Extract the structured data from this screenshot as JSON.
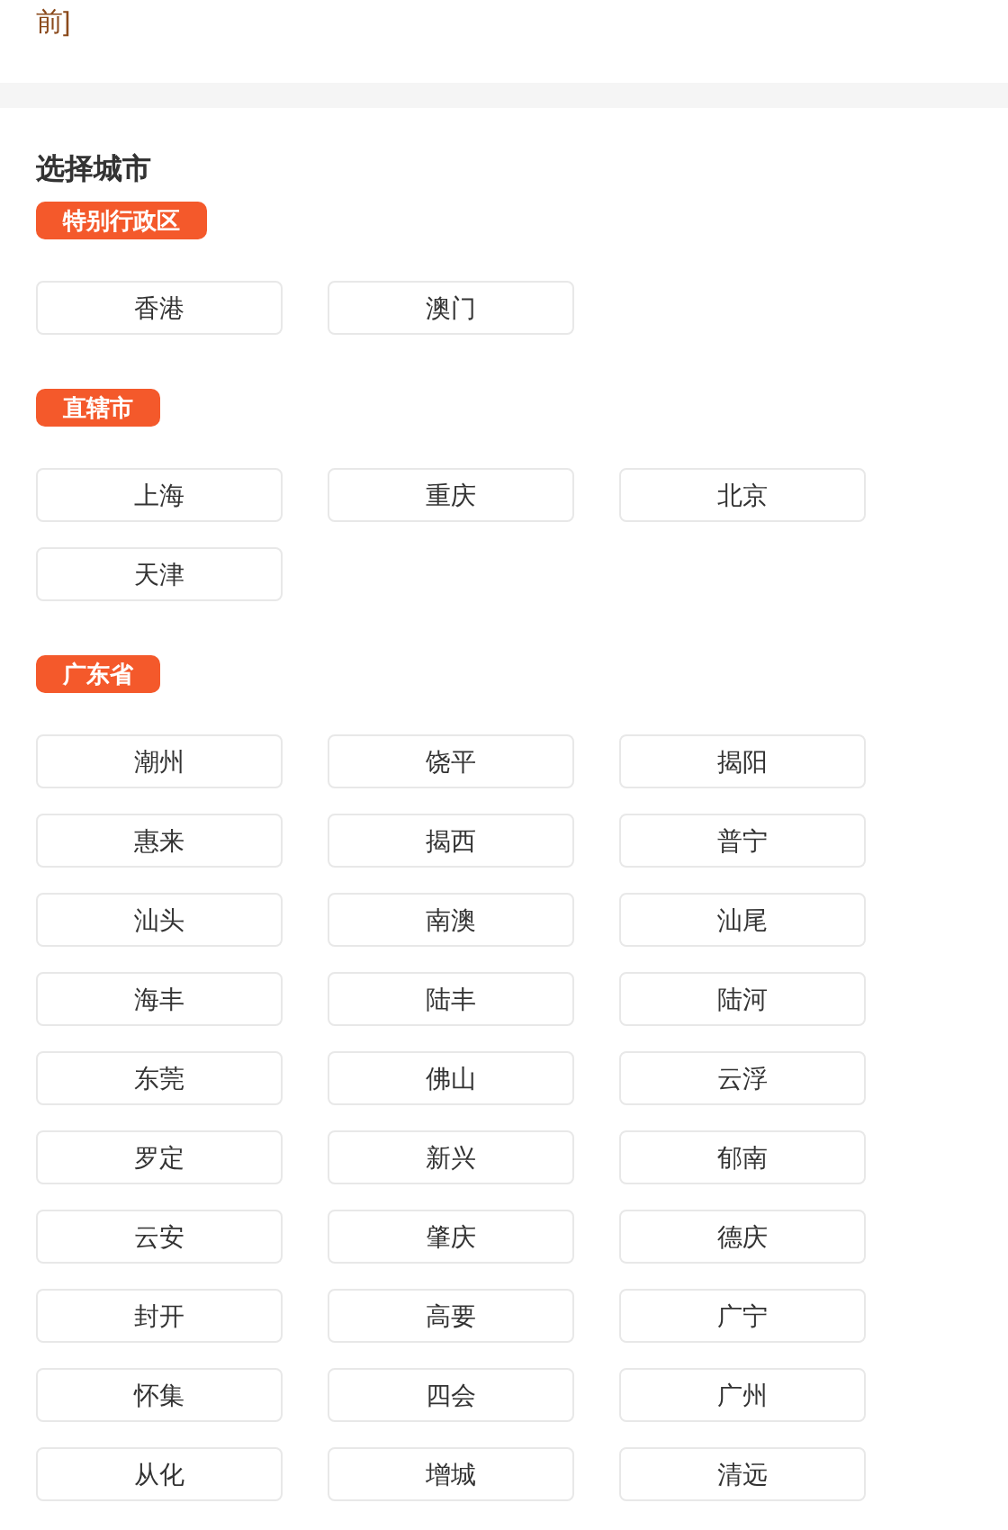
{
  "top_text": "前]",
  "title": "选择城市",
  "groups": [
    {
      "label": "特别行政区",
      "cities": [
        "香港",
        "澳门"
      ]
    },
    {
      "label": "直辖市",
      "cities": [
        "上海",
        "重庆",
        "北京",
        "天津"
      ]
    },
    {
      "label": "广东省",
      "cities": [
        "潮州",
        "饶平",
        "揭阳",
        "惠来",
        "揭西",
        "普宁",
        "汕头",
        "南澳",
        "汕尾",
        "海丰",
        "陆丰",
        "陆河",
        "东莞",
        "佛山",
        "云浮",
        "罗定",
        "新兴",
        "郁南",
        "云安",
        "肇庆",
        "德庆",
        "封开",
        "高要",
        "广宁",
        "怀集",
        "四会",
        "广州",
        "从化",
        "增城",
        "清远"
      ]
    }
  ]
}
